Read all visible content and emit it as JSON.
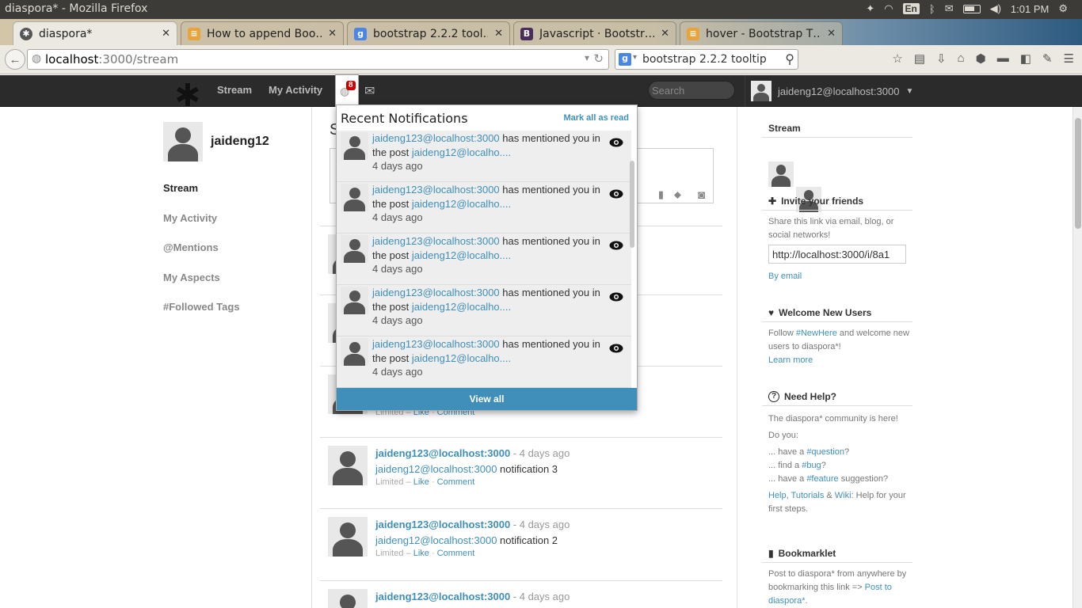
{
  "os": {
    "window_title": "diaspora* - Mozilla Firefox",
    "lang": "En",
    "clock": "1:01 PM"
  },
  "browser": {
    "tabs": [
      {
        "title": "diaspora*",
        "active": true
      },
      {
        "title": "How to append Boo…",
        "active": false
      },
      {
        "title": "bootstrap 2.2.2 tool…",
        "active": false
      },
      {
        "title": "Javascript · Bootstr…",
        "active": false
      },
      {
        "title": "hover - Bootstrap T…",
        "active": false
      }
    ],
    "url_host": "localhost",
    "url_path": ":3000/stream",
    "search_value": "bootstrap 2.2.2 tooltip"
  },
  "header": {
    "nav": [
      "Stream",
      "My Activity"
    ],
    "notification_count": "8",
    "search_placeholder": "Search",
    "user": "jaideng12@localhost:3000"
  },
  "left": {
    "username": "jaideng12",
    "nav": [
      "Stream",
      "My Activity",
      "@Mentions",
      "My Aspects",
      "#Followed Tags"
    ]
  },
  "notifications": {
    "title": "Recent Notifications",
    "mark_all": "Mark all as read",
    "view_all": "View all",
    "items": [
      {
        "who": "jaideng123@localhost:3000",
        "text1": " has mentioned you in",
        "text2": "the post ",
        "post": "jaideng12@localho....",
        "time": "4 days ago"
      },
      {
        "who": "jaideng123@localhost:3000",
        "text1": " has mentioned you in",
        "text2": "the post ",
        "post": "jaideng12@localho....",
        "time": "4 days ago"
      },
      {
        "who": "jaideng123@localhost:3000",
        "text1": " has mentioned you in",
        "text2": "the post ",
        "post": "jaideng12@localho....",
        "time": "4 days ago"
      },
      {
        "who": "jaideng123@localhost:3000",
        "text1": " has mentioned you in",
        "text2": "the post ",
        "post": "jaideng12@localho....",
        "time": "4 days ago"
      },
      {
        "who": "jaideng123@localhost:3000",
        "text1": " has mentioned you in",
        "text2": "the post ",
        "post": "jaideng12@localho....",
        "time": "4 days ago"
      }
    ]
  },
  "stream": {
    "heading_initial": "S",
    "posts": [
      {
        "author": "jaideng123@localhost:3000",
        "time": " - 4 days ago",
        "mention": "jaideng12@localhost:3000",
        "text": " notification 3",
        "meta_scope": "Limited",
        "like": "Like",
        "comment": "Comment"
      },
      {
        "author": "jaideng123@localhost:3000",
        "time": " - 4 days ago",
        "mention": "jaideng12@localhost:3000",
        "text": " notification 2",
        "meta_scope": "Limited",
        "like": "Like",
        "comment": "Comment"
      },
      {
        "author": "jaideng123@localhost:3000",
        "time": " - 4 days ago"
      }
    ],
    "partial_meta": {
      "scope": "Limited",
      "like": "Like",
      "comment": "Comment"
    }
  },
  "right": {
    "stream_title": "Stream",
    "invite": {
      "title": "Invite your friends",
      "text": "Share this link via email, blog, or social networks!",
      "link_value": "http://localhost:3000/i/8a1",
      "by_email": "By email"
    },
    "welcome": {
      "title": "Welcome New Users",
      "t1": "Follow ",
      "tag": "#NewHere",
      "t2": " and welcome new users to diaspora*!",
      "learn": "Learn more"
    },
    "help": {
      "title": "Need Help?",
      "l1": "The diaspora* community is here!",
      "l2": "Do you:",
      "q1a": "... have a ",
      "q1tag": "#question",
      "q1b": "?",
      "q2a": "... find a ",
      "q2tag": "#bug",
      "q2b": "?",
      "q3a": "... have a ",
      "q3tag": "#feature",
      "q3b": " suggestion?",
      "help": "Help",
      "tutorials": "Tutorials",
      "wiki": "Wiki",
      "tail": ": Help for your first steps."
    },
    "bookmarklet": {
      "title": "Bookmarklet",
      "t1": "Post to diaspora* from anywhere by bookmarking this link => ",
      "link": "Post to diaspora*",
      "t2": "."
    }
  }
}
